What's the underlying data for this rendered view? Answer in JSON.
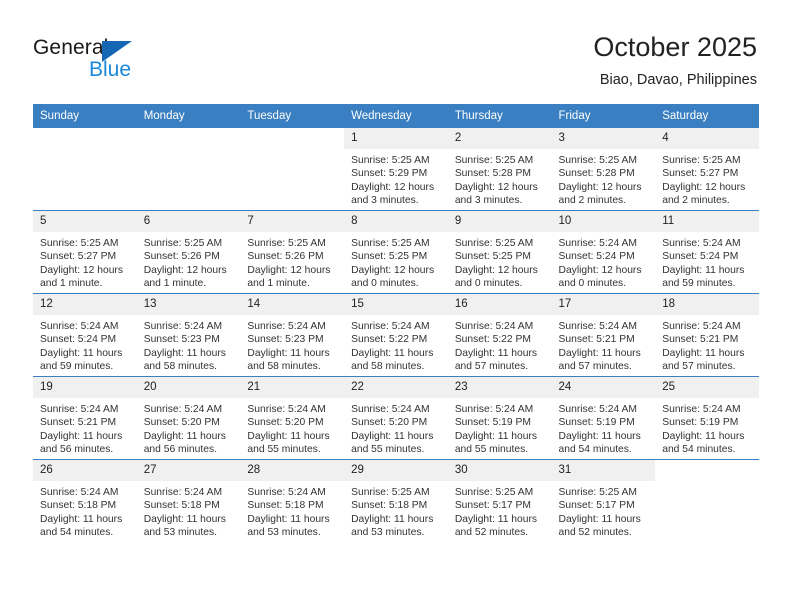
{
  "brand": {
    "name_part1": "General",
    "name_part2": "Blue",
    "triangle_icon": "triangle-icon",
    "color_dark": "#1a1a1a",
    "color_blue": "#1b87d8",
    "color_triangle": "#1567b4"
  },
  "header": {
    "title": "October 2025",
    "subtitle": "Biao, Davao, Philippines",
    "header_bg": "#3a7fc1",
    "header_text": "#ffffff",
    "daynum_bg": "#f0f0f0"
  },
  "weekday_headers": [
    "Sunday",
    "Monday",
    "Tuesday",
    "Wednesday",
    "Thursday",
    "Friday",
    "Saturday"
  ],
  "weeks": [
    [
      {
        "day": "",
        "blank": true,
        "sunrise": "",
        "sunset": "",
        "daylight1": "",
        "daylight2": ""
      },
      {
        "day": "",
        "blank": true,
        "sunrise": "",
        "sunset": "",
        "daylight1": "",
        "daylight2": ""
      },
      {
        "day": "",
        "blank": true,
        "sunrise": "",
        "sunset": "",
        "daylight1": "",
        "daylight2": ""
      },
      {
        "day": "1",
        "sunrise": "Sunrise: 5:25 AM",
        "sunset": "Sunset: 5:29 PM",
        "daylight1": "Daylight: 12 hours",
        "daylight2": "and 3 minutes."
      },
      {
        "day": "2",
        "sunrise": "Sunrise: 5:25 AM",
        "sunset": "Sunset: 5:28 PM",
        "daylight1": "Daylight: 12 hours",
        "daylight2": "and 3 minutes."
      },
      {
        "day": "3",
        "sunrise": "Sunrise: 5:25 AM",
        "sunset": "Sunset: 5:28 PM",
        "daylight1": "Daylight: 12 hours",
        "daylight2": "and 2 minutes."
      },
      {
        "day": "4",
        "sunrise": "Sunrise: 5:25 AM",
        "sunset": "Sunset: 5:27 PM",
        "daylight1": "Daylight: 12 hours",
        "daylight2": "and 2 minutes."
      }
    ],
    [
      {
        "day": "5",
        "sunrise": "Sunrise: 5:25 AM",
        "sunset": "Sunset: 5:27 PM",
        "daylight1": "Daylight: 12 hours",
        "daylight2": "and 1 minute."
      },
      {
        "day": "6",
        "sunrise": "Sunrise: 5:25 AM",
        "sunset": "Sunset: 5:26 PM",
        "daylight1": "Daylight: 12 hours",
        "daylight2": "and 1 minute."
      },
      {
        "day": "7",
        "sunrise": "Sunrise: 5:25 AM",
        "sunset": "Sunset: 5:26 PM",
        "daylight1": "Daylight: 12 hours",
        "daylight2": "and 1 minute."
      },
      {
        "day": "8",
        "sunrise": "Sunrise: 5:25 AM",
        "sunset": "Sunset: 5:25 PM",
        "daylight1": "Daylight: 12 hours",
        "daylight2": "and 0 minutes."
      },
      {
        "day": "9",
        "sunrise": "Sunrise: 5:25 AM",
        "sunset": "Sunset: 5:25 PM",
        "daylight1": "Daylight: 12 hours",
        "daylight2": "and 0 minutes."
      },
      {
        "day": "10",
        "sunrise": "Sunrise: 5:24 AM",
        "sunset": "Sunset: 5:24 PM",
        "daylight1": "Daylight: 12 hours",
        "daylight2": "and 0 minutes."
      },
      {
        "day": "11",
        "sunrise": "Sunrise: 5:24 AM",
        "sunset": "Sunset: 5:24 PM",
        "daylight1": "Daylight: 11 hours",
        "daylight2": "and 59 minutes."
      }
    ],
    [
      {
        "day": "12",
        "sunrise": "Sunrise: 5:24 AM",
        "sunset": "Sunset: 5:24 PM",
        "daylight1": "Daylight: 11 hours",
        "daylight2": "and 59 minutes."
      },
      {
        "day": "13",
        "sunrise": "Sunrise: 5:24 AM",
        "sunset": "Sunset: 5:23 PM",
        "daylight1": "Daylight: 11 hours",
        "daylight2": "and 58 minutes."
      },
      {
        "day": "14",
        "sunrise": "Sunrise: 5:24 AM",
        "sunset": "Sunset: 5:23 PM",
        "daylight1": "Daylight: 11 hours",
        "daylight2": "and 58 minutes."
      },
      {
        "day": "15",
        "sunrise": "Sunrise: 5:24 AM",
        "sunset": "Sunset: 5:22 PM",
        "daylight1": "Daylight: 11 hours",
        "daylight2": "and 58 minutes."
      },
      {
        "day": "16",
        "sunrise": "Sunrise: 5:24 AM",
        "sunset": "Sunset: 5:22 PM",
        "daylight1": "Daylight: 11 hours",
        "daylight2": "and 57 minutes."
      },
      {
        "day": "17",
        "sunrise": "Sunrise: 5:24 AM",
        "sunset": "Sunset: 5:21 PM",
        "daylight1": "Daylight: 11 hours",
        "daylight2": "and 57 minutes."
      },
      {
        "day": "18",
        "sunrise": "Sunrise: 5:24 AM",
        "sunset": "Sunset: 5:21 PM",
        "daylight1": "Daylight: 11 hours",
        "daylight2": "and 57 minutes."
      }
    ],
    [
      {
        "day": "19",
        "sunrise": "Sunrise: 5:24 AM",
        "sunset": "Sunset: 5:21 PM",
        "daylight1": "Daylight: 11 hours",
        "daylight2": "and 56 minutes."
      },
      {
        "day": "20",
        "sunrise": "Sunrise: 5:24 AM",
        "sunset": "Sunset: 5:20 PM",
        "daylight1": "Daylight: 11 hours",
        "daylight2": "and 56 minutes."
      },
      {
        "day": "21",
        "sunrise": "Sunrise: 5:24 AM",
        "sunset": "Sunset: 5:20 PM",
        "daylight1": "Daylight: 11 hours",
        "daylight2": "and 55 minutes."
      },
      {
        "day": "22",
        "sunrise": "Sunrise: 5:24 AM",
        "sunset": "Sunset: 5:20 PM",
        "daylight1": "Daylight: 11 hours",
        "daylight2": "and 55 minutes."
      },
      {
        "day": "23",
        "sunrise": "Sunrise: 5:24 AM",
        "sunset": "Sunset: 5:19 PM",
        "daylight1": "Daylight: 11 hours",
        "daylight2": "and 55 minutes."
      },
      {
        "day": "24",
        "sunrise": "Sunrise: 5:24 AM",
        "sunset": "Sunset: 5:19 PM",
        "daylight1": "Daylight: 11 hours",
        "daylight2": "and 54 minutes."
      },
      {
        "day": "25",
        "sunrise": "Sunrise: 5:24 AM",
        "sunset": "Sunset: 5:19 PM",
        "daylight1": "Daylight: 11 hours",
        "daylight2": "and 54 minutes."
      }
    ],
    [
      {
        "day": "26",
        "sunrise": "Sunrise: 5:24 AM",
        "sunset": "Sunset: 5:18 PM",
        "daylight1": "Daylight: 11 hours",
        "daylight2": "and 54 minutes."
      },
      {
        "day": "27",
        "sunrise": "Sunrise: 5:24 AM",
        "sunset": "Sunset: 5:18 PM",
        "daylight1": "Daylight: 11 hours",
        "daylight2": "and 53 minutes."
      },
      {
        "day": "28",
        "sunrise": "Sunrise: 5:24 AM",
        "sunset": "Sunset: 5:18 PM",
        "daylight1": "Daylight: 11 hours",
        "daylight2": "and 53 minutes."
      },
      {
        "day": "29",
        "sunrise": "Sunrise: 5:25 AM",
        "sunset": "Sunset: 5:18 PM",
        "daylight1": "Daylight: 11 hours",
        "daylight2": "and 53 minutes."
      },
      {
        "day": "30",
        "sunrise": "Sunrise: 5:25 AM",
        "sunset": "Sunset: 5:17 PM",
        "daylight1": "Daylight: 11 hours",
        "daylight2": "and 52 minutes."
      },
      {
        "day": "31",
        "sunrise": "Sunrise: 5:25 AM",
        "sunset": "Sunset: 5:17 PM",
        "daylight1": "Daylight: 11 hours",
        "daylight2": "and 52 minutes."
      },
      {
        "day": "",
        "blank": true,
        "sunrise": "",
        "sunset": "",
        "daylight1": "",
        "daylight2": ""
      }
    ]
  ]
}
